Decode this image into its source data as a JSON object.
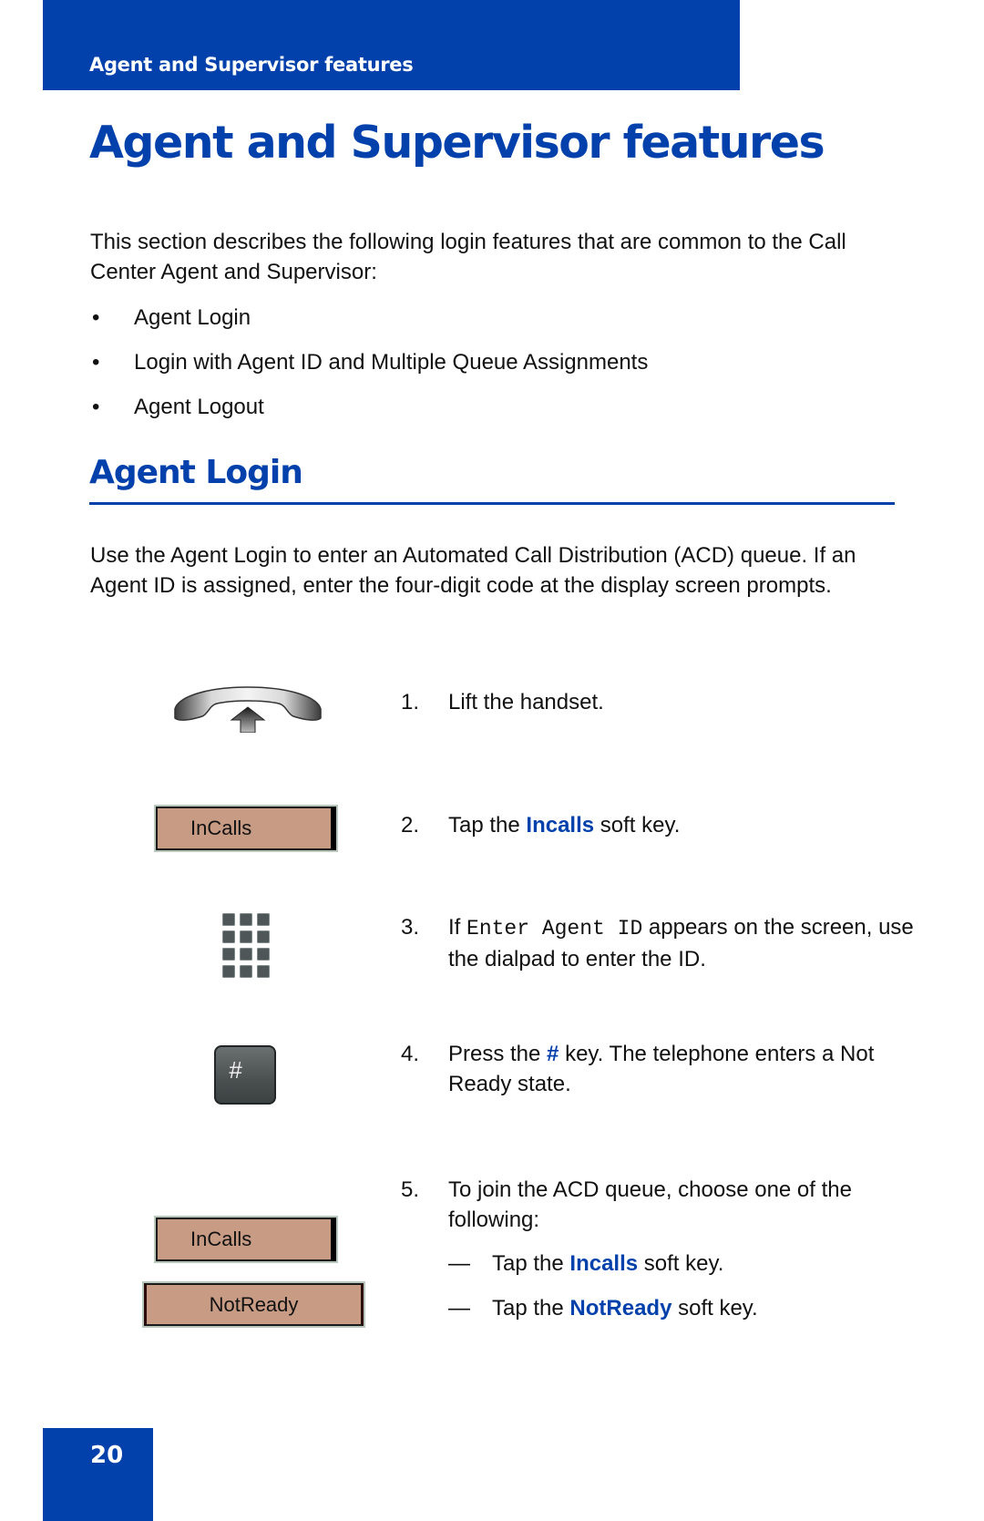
{
  "header": {
    "band_title": "Agent and Supervisor features",
    "page_title": "Agent and Supervisor features"
  },
  "intro": {
    "text": "This section describes the following login features that are common to the Call Center Agent and Supervisor:",
    "bullets": [
      {
        "symbol": "•",
        "label": "Agent Login"
      },
      {
        "symbol": "•",
        "label": "Login with Agent ID and Multiple Queue Assignments"
      },
      {
        "symbol": "•",
        "label": "Agent Logout"
      }
    ]
  },
  "section": {
    "title": "Agent Login",
    "paragraph": "Use the Agent Login to enter an Automated Call Distribution (ACD) queue. If an Agent ID is assigned, enter the four-digit code at the display screen prompts."
  },
  "steps": [
    {
      "num": "1.",
      "text": "Lift the handset.",
      "icon": "handset-lift-icon"
    },
    {
      "num": "2.",
      "pre": "Tap the ",
      "key": "Incalls",
      "post": " soft key.",
      "icon": "incalls-softkey"
    },
    {
      "num": "3.",
      "pre": "If ",
      "mono": "Enter Agent ID",
      "post": " appears on the screen, use the dialpad to enter the ID.",
      "icon": "dialpad-icon"
    },
    {
      "num": "4.",
      "pre": "Press the ",
      "key": "#",
      "post": " key. The telephone enters a Not Ready state.",
      "icon": "hash-key-icon"
    },
    {
      "num": "5.",
      "text": "To join the ACD queue, choose one of the following:",
      "options": [
        {
          "dash": "—",
          "pre": "Tap the ",
          "key": "Incalls",
          "post": " soft key."
        },
        {
          "dash": "—",
          "pre": "Tap the ",
          "key": "NotReady",
          "post": " soft key."
        }
      ]
    }
  ],
  "softkeys": {
    "incalls_label": "InCalls",
    "notready_label": "NotReady",
    "hash_label": "#"
  },
  "colors": {
    "brand_blue": "#0241ac",
    "softkey_fill": "#c89c84"
  },
  "footer": {
    "page_number": "20"
  }
}
